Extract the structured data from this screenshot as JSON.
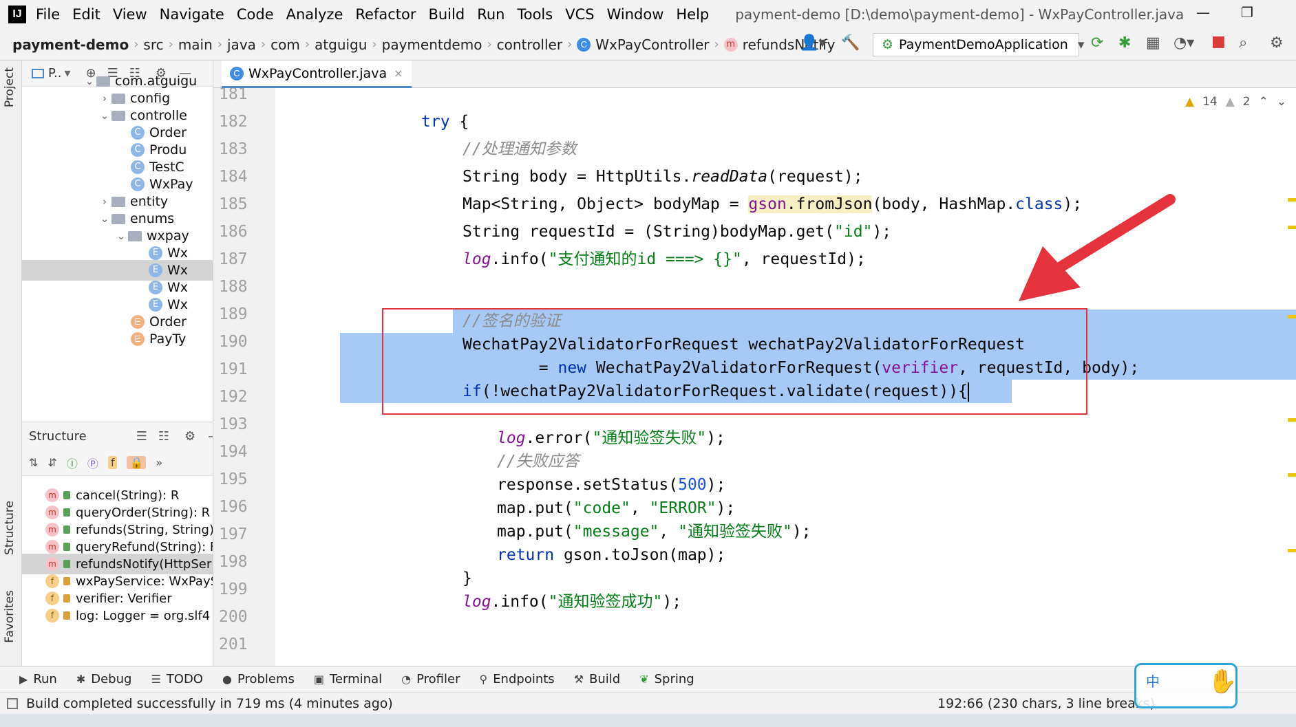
{
  "menubar": {
    "items": [
      "File",
      "Edit",
      "View",
      "Navigate",
      "Code",
      "Analyze",
      "Refactor",
      "Build",
      "Run",
      "Tools",
      "VCS",
      "Window",
      "Help"
    ],
    "window_title": "payment-demo [D:\\demo\\payment-demo] - WxPayController.java"
  },
  "navbar": {
    "project": "payment-demo",
    "breadcrumbs": [
      "src",
      "main",
      "java",
      "com",
      "atguigu",
      "paymentdemo",
      "controller"
    ],
    "class_crumb": "WxPayController",
    "method_crumb": "refundsNotify",
    "run_config": "PaymentDemoApplication"
  },
  "left_strip": {
    "project": "Project",
    "structure": "Structure",
    "favorites": "Favorites"
  },
  "project_panel": {
    "header": "P..",
    "tree": [
      {
        "label": "com.atguigu",
        "type": "package",
        "arrow": "v"
      },
      {
        "label": "config",
        "type": "folder",
        "arrow": ">"
      },
      {
        "label": "controlle",
        "type": "folder",
        "arrow": "v"
      },
      {
        "label": "Order",
        "type": "class"
      },
      {
        "label": "Produ",
        "type": "class"
      },
      {
        "label": "TestC",
        "type": "class"
      },
      {
        "label": "WxPay",
        "type": "class"
      },
      {
        "label": "entity",
        "type": "folder",
        "arrow": ">"
      },
      {
        "label": "enums",
        "type": "folder",
        "arrow": "v"
      },
      {
        "label": "wxpay",
        "type": "folder",
        "arrow": "v"
      },
      {
        "label": "Wx",
        "type": "enum"
      },
      {
        "label": "Wx",
        "type": "enum",
        "selected": true
      },
      {
        "label": "Wx",
        "type": "enum"
      },
      {
        "label": "Wx",
        "type": "enum"
      },
      {
        "label": "Order",
        "type": "enum"
      },
      {
        "label": "PayTy",
        "type": "enum"
      }
    ]
  },
  "structure_panel": {
    "title": "Structure",
    "items": [
      {
        "icon": "m",
        "label": "cancel(String): R"
      },
      {
        "icon": "m",
        "label": "queryOrder(String): R"
      },
      {
        "icon": "m",
        "label": "refunds(String, String)"
      },
      {
        "icon": "m",
        "label": "queryRefund(String): F"
      },
      {
        "icon": "m",
        "label": "refundsNotify(HttpSer",
        "selected": true
      },
      {
        "icon": "f",
        "label": "wxPayService: WxPayS"
      },
      {
        "icon": "f",
        "label": "verifier: Verifier"
      },
      {
        "icon": "f",
        "label": "log: Logger = org.slf4"
      }
    ]
  },
  "editor": {
    "tab": "WxPayController.java",
    "warnings": "14",
    "weak_warnings": "2",
    "line_numbers": [
      "181",
      "182",
      "183",
      "184",
      "185",
      "186",
      "187",
      "188",
      "189",
      "190",
      "191",
      "192",
      "193",
      "194",
      "195",
      "196",
      "197",
      "198",
      "199",
      "200",
      "201"
    ],
    "lines": {
      "l182_kw": "try",
      "l182_rest": " {",
      "l183": "//处理通知参数",
      "l184_a": "String body = HttpUtils.",
      "l184_b": "readData",
      "l184_c": "(request);",
      "l185_a": "Map<String, Object> bodyMap = ",
      "l185_b": "gson",
      "l185_c": ".fromJson",
      "l185_d": "(body, HashMap.",
      "l185_e": "class",
      "l185_f": ");",
      "l186_a": "String requestId = (String)bodyMap.get(",
      "l186_b": "\"id\"",
      "l186_c": ");",
      "l187_a": "log",
      "l187_b": ".info(",
      "l187_c": "\"支付通知的id ===> {}\"",
      "l187_d": ", requestId);",
      "l189": "//签名的验证",
      "l190": "WechatPay2ValidatorForRequest wechatPay2ValidatorForRequest",
      "l191_a": "        = ",
      "l191_b": "new",
      "l191_c": " WechatPay2ValidatorForRequest(",
      "l191_d": "verifier",
      "l191_e": ", requestId, body);",
      "l192_a": "if",
      "l192_b": "(!wechatPay2ValidatorForRequest.validate(request)){",
      "l194_a": "log",
      "l194_b": ".error(",
      "l194_c": "\"通知验签失败\"",
      "l194_d": ");",
      "l195": "//失败应答",
      "l196_a": "response.setStatus(",
      "l196_b": "500",
      "l196_c": ");",
      "l197_a": "map.put(",
      "l197_b": "\"code\"",
      "l197_c": ", ",
      "l197_d": "\"ERROR\"",
      "l197_e": ");",
      "l198_a": "map.put(",
      "l198_b": "\"message\"",
      "l198_c": ", ",
      "l198_d": "\"通知验签失败\"",
      "l198_e": ");",
      "l199_a": "return",
      "l199_b": " gson.toJson(map);",
      "l200": "}",
      "l201_a": "log",
      "l201_b": ".info(",
      "l201_c": "\"通知验签成功\"",
      "l201_d": ");"
    }
  },
  "bottom_tools": [
    "Run",
    "Debug",
    "TODO",
    "Problems",
    "Terminal",
    "Profiler",
    "Endpoints",
    "Build",
    "Spring"
  ],
  "status": {
    "message": "Build completed successfully in 719 ms (4 minutes ago)",
    "position": "192:66 (230 chars, 3 line breaks)"
  },
  "colors": {
    "selection": "#a6c9f5",
    "highlight_box": "#e4333d",
    "arrow": "#e4333d",
    "keyword": "#0033b3",
    "string": "#067d17"
  }
}
